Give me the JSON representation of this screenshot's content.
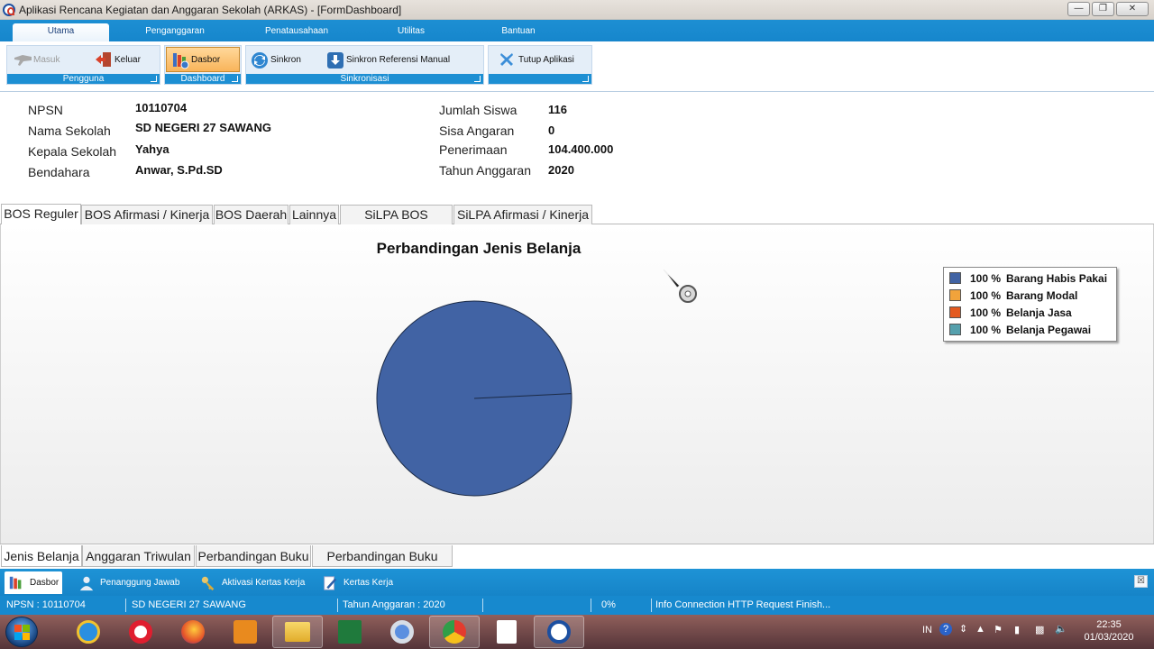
{
  "window": {
    "title": "Aplikasi Rencana Kegiatan dan Anggaran Sekolah (ARKAS) - [FormDashboard]",
    "minimize_label": "",
    "maximize_label": "",
    "close_label": ""
  },
  "ribbon": {
    "tabs": [
      {
        "label": "Utama"
      },
      {
        "label": "Penganggaran"
      },
      {
        "label": "Penatausahaan"
      },
      {
        "label": "Utilitas"
      },
      {
        "label": "Bantuan"
      }
    ],
    "groups": {
      "pengguna": {
        "label": "Pengguna",
        "masuk": "Masuk",
        "keluar": "Keluar"
      },
      "dashboard": {
        "label": "Dashboard",
        "dasbor": "Dasbor"
      },
      "sinkronisasi": {
        "label": "Sinkronisasi",
        "sinkron": "Sinkron",
        "sinkron_ref": "Sinkron Referensi Manual"
      },
      "other": {
        "tutup": "Tutup Aplikasi"
      }
    }
  },
  "info": {
    "npsn_label": "NPSN",
    "npsn": "10110704",
    "nama_label": "Nama Sekolah",
    "nama": "SD NEGERI 27 SAWANG",
    "kepala_label": "Kepala Sekolah",
    "kepala": "Yahya",
    "bendahara_label": "Bendahara",
    "bendahara": "Anwar, S.Pd.SD",
    "siswa_label": "Jumlah Siswa",
    "siswa": "116",
    "sisa_label": "Sisa Angaran",
    "sisa": "0",
    "penerimaan_label": "Penerimaan",
    "penerimaan": "104.400.000",
    "tahun_label": "Tahun Anggaran",
    "tahun": "2020"
  },
  "tabs_top": [
    {
      "label": "BOS Reguler"
    },
    {
      "label": "BOS Afirmasi / Kinerja"
    },
    {
      "label": "BOS Daerah"
    },
    {
      "label": "Lainnya"
    },
    {
      "label": "SiLPA BOS Reguler"
    },
    {
      "label": "SiLPA Afirmasi / Kinerja"
    }
  ],
  "chart_data": {
    "type": "pie",
    "title": "Perbandingan Jenis Belanja",
    "categories": [
      "Barang Habis Pakai",
      "Barang Modal",
      "Belanja Jasa",
      "Belanja Pegawai"
    ],
    "values": [
      100,
      0,
      0,
      0
    ],
    "legend_labels": [
      "100 %",
      "100 %",
      "100 %",
      "100 %"
    ],
    "colors": [
      "#4163a4",
      "#f1a33b",
      "#e35a20",
      "#55a0ad"
    ],
    "legend_position": "top-right"
  },
  "tabs_bottom": [
    {
      "label": "Jenis Belanja"
    },
    {
      "label": "Anggaran Triwulan"
    },
    {
      "label": "Perbandingan Buku"
    },
    {
      "label": "Perbandingan Buku Sisa"
    }
  ],
  "mdi": [
    {
      "label": "Dasbor"
    },
    {
      "label": "Penanggung Jawab"
    },
    {
      "label": "Aktivasi Kertas Kerja"
    },
    {
      "label": "Kertas Kerja"
    }
  ],
  "mdi_close": "☒",
  "status": {
    "npsn": "NPSN : 10110704",
    "school": "SD NEGERI 27 SAWANG",
    "year": "Tahun Anggaran : 2020",
    "progress": "0%",
    "info": "Info Connection HTTP Request Finish..."
  },
  "taskbar": {
    "lang": "IN",
    "time": "22:35",
    "date": "01/03/2020"
  }
}
